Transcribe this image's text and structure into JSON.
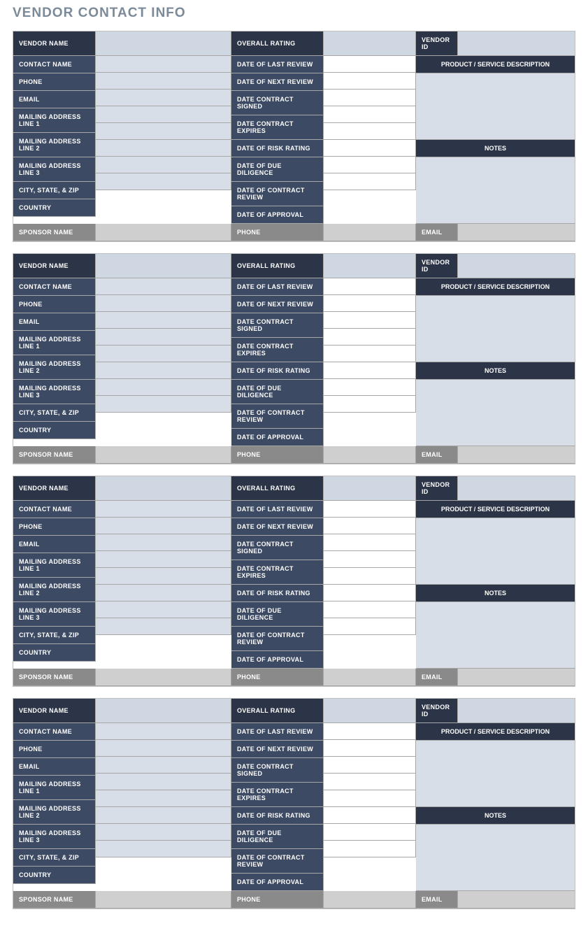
{
  "title": "VENDOR CONTACT INFO",
  "blocks": [
    {
      "vendorName": "",
      "overallRating": "",
      "vendorId": "",
      "contactName": "",
      "phone": "",
      "email": "",
      "addr1": "",
      "addr2": "",
      "addr3": "",
      "cityStateZip": "",
      "country": "",
      "dateLastReview": "",
      "dateNextReview": "",
      "dateContractSigned": "",
      "dateContractExpires": "",
      "dateRiskRating": "",
      "dateDueDiligence": "",
      "dateContractReview": "",
      "dateApproval": "",
      "productDesc": "",
      "notes": "",
      "sponsorName": "",
      "sponsorPhone": "",
      "sponsorEmail": ""
    },
    {
      "vendorName": "",
      "overallRating": "",
      "vendorId": "",
      "contactName": "",
      "phone": "",
      "email": "",
      "addr1": "",
      "addr2": "",
      "addr3": "",
      "cityStateZip": "",
      "country": "",
      "dateLastReview": "",
      "dateNextReview": "",
      "dateContractSigned": "",
      "dateContractExpires": "",
      "dateRiskRating": "",
      "dateDueDiligence": "",
      "dateContractReview": "",
      "dateApproval": "",
      "productDesc": "",
      "notes": "",
      "sponsorName": "",
      "sponsorPhone": "",
      "sponsorEmail": ""
    },
    {
      "vendorName": "",
      "overallRating": "",
      "vendorId": "",
      "contactName": "",
      "phone": "",
      "email": "",
      "addr1": "",
      "addr2": "",
      "addr3": "",
      "cityStateZip": "",
      "country": "",
      "dateLastReview": "",
      "dateNextReview": "",
      "dateContractSigned": "",
      "dateContractExpires": "",
      "dateRiskRating": "",
      "dateDueDiligence": "",
      "dateContractReview": "",
      "dateApproval": "",
      "productDesc": "",
      "notes": "",
      "sponsorName": "",
      "sponsorPhone": "",
      "sponsorEmail": ""
    },
    {
      "vendorName": "",
      "overallRating": "",
      "vendorId": "",
      "contactName": "",
      "phone": "",
      "email": "",
      "addr1": "",
      "addr2": "",
      "addr3": "",
      "cityStateZip": "",
      "country": "",
      "dateLastReview": "",
      "dateNextReview": "",
      "dateContractSigned": "",
      "dateContractExpires": "",
      "dateRiskRating": "",
      "dateDueDiligence": "",
      "dateContractReview": "",
      "dateApproval": "",
      "productDesc": "",
      "notes": "",
      "sponsorName": "",
      "sponsorPhone": "",
      "sponsorEmail": ""
    }
  ],
  "labels": {
    "vendorName": "VENDOR NAME",
    "overallRating": "OVERALL RATING",
    "vendorId": "VENDOR ID",
    "contactName": "CONTACT NAME",
    "phone": "PHONE",
    "email": "EMAIL",
    "addr1": "MAILING ADDRESS LINE 1",
    "addr2": "MAILING ADDRESS LINE 2",
    "addr3": "MAILING ADDRESS LINE 3",
    "cityStateZip": "CITY, STATE, & ZIP",
    "country": "COUNTRY",
    "dateLastReview": "DATE OF LAST REVIEW",
    "dateNextReview": "DATE OF NEXT REVIEW",
    "dateContractSigned": "DATE CONTRACT SIGNED",
    "dateContractExpires": "DATE CONTRACT EXPIRES",
    "dateRiskRating": "DATE OF RISK RATING",
    "dateDueDiligence": "DATE OF DUE DILIGENCE",
    "dateContractReview": "DATE OF CONTRACT REVIEW",
    "dateApproval": "DATE OF APPROVAL",
    "productDesc": "PRODUCT / SERVICE DESCRIPTION",
    "notes": "NOTES",
    "sponsorName": "SPONSOR NAME",
    "sponsorPhone": "PHONE",
    "sponsorEmail": "EMAIL"
  }
}
